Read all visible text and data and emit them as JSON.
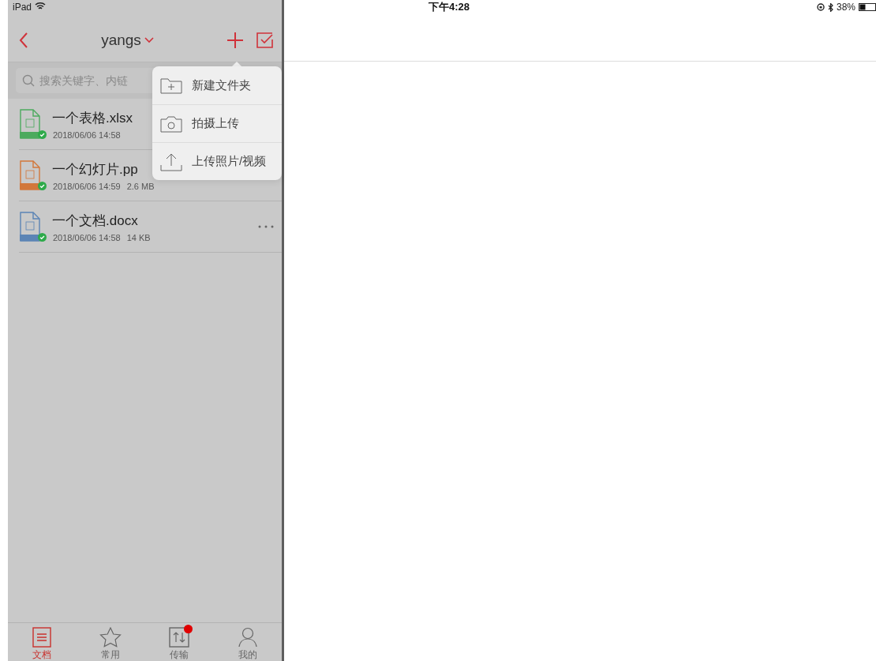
{
  "status_bar": {
    "device": "iPad",
    "time": "下午4:28",
    "battery": "38%"
  },
  "nav": {
    "title": "yangs"
  },
  "search": {
    "placeholder": "搜索关键字、内链"
  },
  "files": [
    {
      "kind": "excel",
      "name": "一个表格.xlsx",
      "date": "2018/06/06 14:58",
      "synced": true,
      "more": false
    },
    {
      "kind": "ppt",
      "name": "一个幻灯片.pp",
      "date": "2018/06/06 14:59",
      "size": "2.6 MB",
      "synced": true,
      "more": false
    },
    {
      "kind": "word",
      "name": "一个文档.docx",
      "date": "2018/06/06 14:58",
      "size": "14 KB",
      "synced": true,
      "more": true
    }
  ],
  "popover": {
    "items": [
      {
        "kind": "folder",
        "label": "新建文件夹"
      },
      {
        "kind": "camera",
        "label": "拍摄上传"
      },
      {
        "kind": "upload",
        "label": "上传照片/视频"
      }
    ]
  },
  "tabs": [
    {
      "kind": "docs",
      "label": "文档",
      "selected": true,
      "badge": false
    },
    {
      "kind": "star",
      "label": "常用",
      "selected": false,
      "badge": false
    },
    {
      "kind": "transfer",
      "label": "传输",
      "selected": false,
      "badge": true
    },
    {
      "kind": "me",
      "label": "我的",
      "selected": false,
      "badge": false
    }
  ]
}
